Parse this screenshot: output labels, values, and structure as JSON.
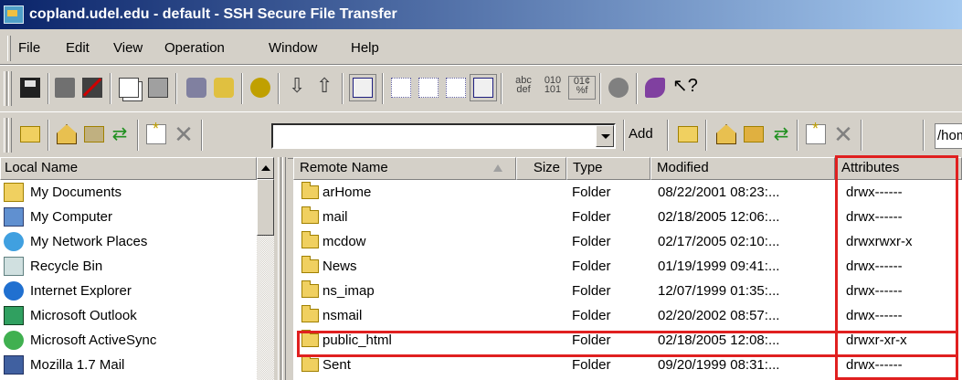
{
  "window": {
    "title": "copland.udel.edu - default - SSH Secure File Transfer"
  },
  "menu": {
    "items": [
      "File",
      "Edit",
      "View",
      "Operation",
      "Window",
      "Help"
    ]
  },
  "toolbar2": {
    "local_path": "",
    "add_label": "Add",
    "remote_path": "/home/usra/"
  },
  "local": {
    "header": "Local Name",
    "items": [
      {
        "name": "My Documents",
        "icon": "my-documents-icon"
      },
      {
        "name": "My Computer",
        "icon": "my-computer-icon"
      },
      {
        "name": "My Network Places",
        "icon": "network-places-icon"
      },
      {
        "name": "Recycle Bin",
        "icon": "recycle-bin-icon"
      },
      {
        "name": "Internet Explorer",
        "icon": "internet-explorer-icon"
      },
      {
        "name": "Microsoft Outlook",
        "icon": "outlook-icon"
      },
      {
        "name": "Microsoft ActiveSync",
        "icon": "activesync-icon"
      },
      {
        "name": "Mozilla 1.7 Mail",
        "icon": "mozilla-mail-icon"
      }
    ]
  },
  "remote": {
    "columns": {
      "name": "Remote Name",
      "size": "Size",
      "type": "Type",
      "modified": "Modified",
      "attributes": "Attributes"
    },
    "rows": [
      {
        "name": "arHome",
        "size": "",
        "type": "Folder",
        "modified": "08/22/2001 08:23:...",
        "attributes": "drwx------"
      },
      {
        "name": "mail",
        "size": "",
        "type": "Folder",
        "modified": "02/18/2005 12:06:...",
        "attributes": "drwx------"
      },
      {
        "name": "mcdow",
        "size": "",
        "type": "Folder",
        "modified": "02/17/2005 02:10:...",
        "attributes": "drwxrwxr-x"
      },
      {
        "name": "News",
        "size": "",
        "type": "Folder",
        "modified": "01/19/1999 09:41:...",
        "attributes": "drwx------"
      },
      {
        "name": "ns_imap",
        "size": "",
        "type": "Folder",
        "modified": "12/07/1999 01:35:...",
        "attributes": "drwx------"
      },
      {
        "name": "nsmail",
        "size": "",
        "type": "Folder",
        "modified": "02/20/2002 08:57:...",
        "attributes": "drwx------"
      },
      {
        "name": "public_html",
        "size": "",
        "type": "Folder",
        "modified": "02/18/2005 12:08:...",
        "attributes": "drwxr-xr-x"
      },
      {
        "name": "Sent",
        "size": "",
        "type": "Folder",
        "modified": "09/20/1999 08:31:...",
        "attributes": "drwx------"
      }
    ]
  },
  "colors": {
    "highlight_box": "#e02020",
    "titlebar_start": "#0a246a",
    "titlebar_end": "#a6caf0",
    "chrome": "#d4d0c8"
  }
}
